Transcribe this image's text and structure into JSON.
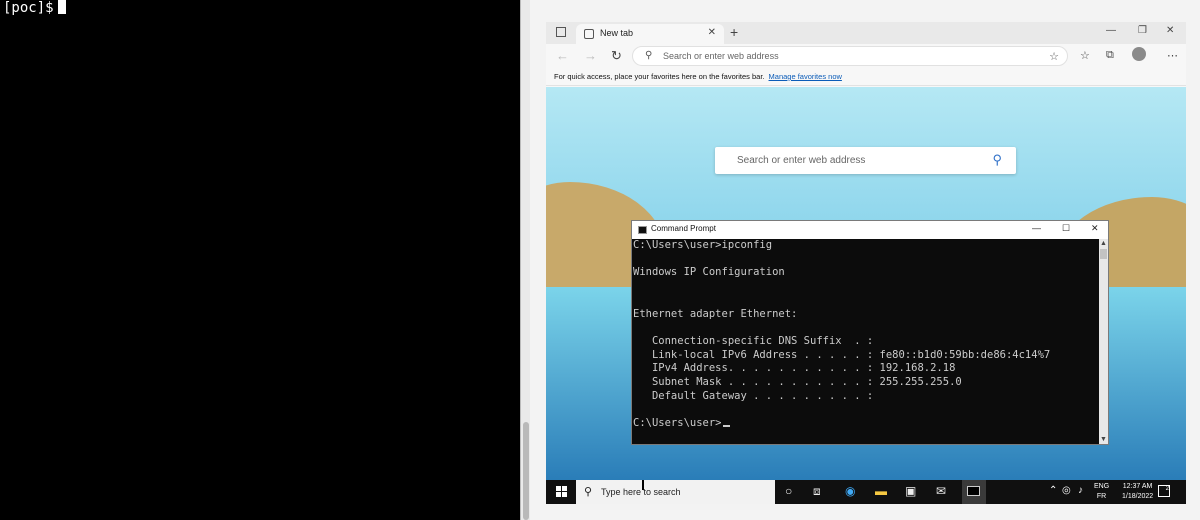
{
  "left_terminal": {
    "prompt": "[poc]$"
  },
  "browser": {
    "tab": {
      "label": "New tab",
      "close": "✕"
    },
    "new_tab": "+",
    "window_controls": {
      "minimize": "—",
      "restore": "❐",
      "close": "✕"
    },
    "nav": {
      "back": "←",
      "forward": "→",
      "refresh": "↻"
    },
    "address_placeholder": "Search or enter web address",
    "favorites_bar": {
      "message": "For quick access, place your favorites here on the favorites bar.",
      "link": "Manage favorites now"
    },
    "page_search_placeholder": "Search or enter web address"
  },
  "cmd": {
    "title": "Command Prompt",
    "controls": {
      "minimize": "—",
      "maximize": "☐",
      "close": "✕"
    },
    "lines": [
      "C:\\Users\\user>ipconfig",
      "",
      "Windows IP Configuration",
      "",
      "",
      "Ethernet adapter Ethernet:",
      "",
      "   Connection-specific DNS Suffix  . :",
      "   Link-local IPv6 Address . . . . . : fe80::b1d0:59bb:de86:4c14%7",
      "   IPv4 Address. . . . . . . . . . . : 192.168.2.18",
      "   Subnet Mask . . . . . . . . . . . : 255.255.255.0",
      "   Default Gateway . . . . . . . . . :",
      ""
    ],
    "current_prompt": "C:\\Users\\user>"
  },
  "taskbar": {
    "search_placeholder": "Type here to search",
    "lang_primary": "ENG",
    "lang_secondary": "FR",
    "time": "12:37 AM",
    "date": "1/18/2022",
    "notification_count": "2"
  }
}
